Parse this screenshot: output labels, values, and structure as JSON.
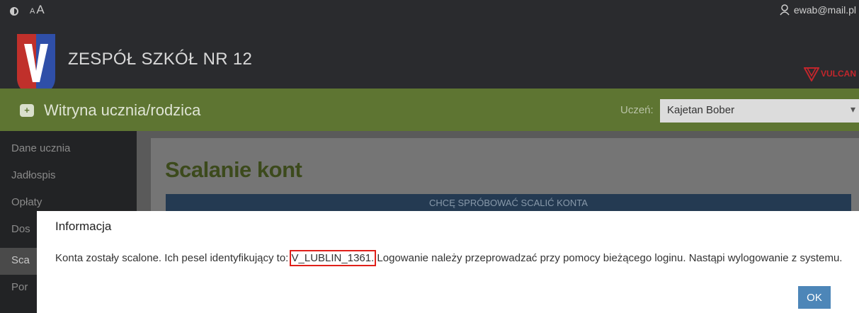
{
  "header": {
    "font_size_small": "A",
    "font_size_large": "A",
    "user_email": "ewab@mail.pl",
    "school_name": "ZESPÓŁ SZKÓŁ NR 12",
    "vendor_logo_text": "VULCAN"
  },
  "portal": {
    "title": "Witryna ucznia/rodzica",
    "icon_glyph": "+",
    "student_label": "Uczeń:",
    "student_selected": "Kajetan Bober",
    "chevron": "▾"
  },
  "sidebar": {
    "items": [
      {
        "label": "Dane ucznia"
      },
      {
        "label": "Jadłospis"
      },
      {
        "label": "Opłaty"
      },
      {
        "label": "Dos"
      },
      {
        "label": "Sca"
      },
      {
        "label": "Por"
      }
    ]
  },
  "main": {
    "title": "Scalanie kont",
    "merge_button_label": "CHCĘ SPRÓBOWAĆ SCALIĆ KONTA"
  },
  "modal": {
    "title": "Informacja",
    "message_before": "Konta zostały scalone. Ich pesel identyfikujący to: ",
    "message_highlight": "V_LUBLIN_1361.",
    "message_after": " Logowanie należy przeprowadzać przy pomocy bieżącego loginu. Nastąpi wylogowanie z systemu.",
    "ok_label": "OK"
  },
  "colors": {
    "topbar": "#2a2b2e",
    "greenbar": "#5e7532",
    "ok_button": "#4d86b8",
    "highlight_box": "#e0201a"
  }
}
